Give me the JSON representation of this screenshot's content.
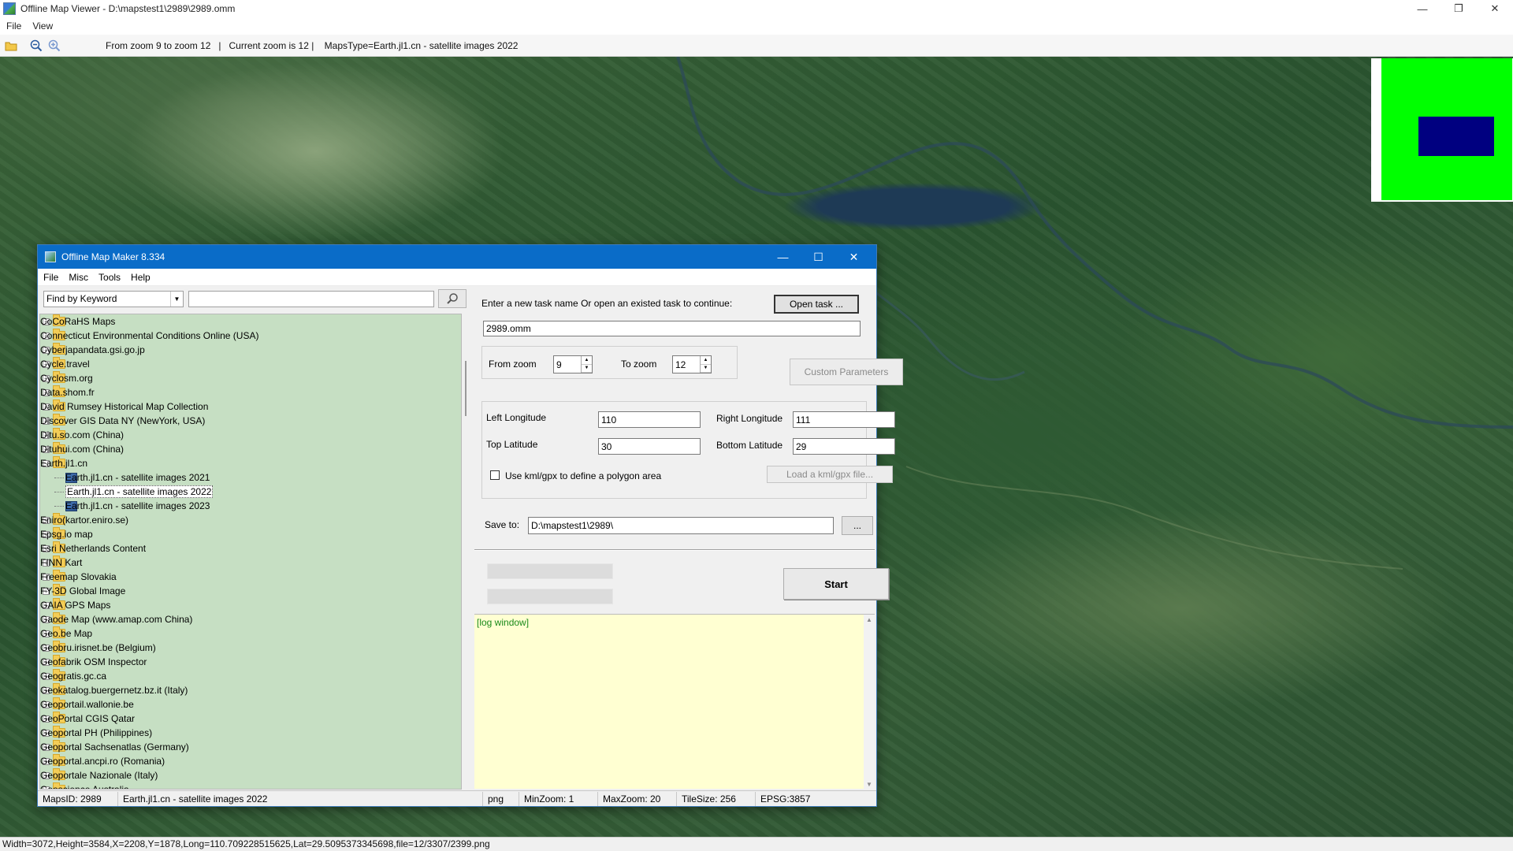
{
  "viewer": {
    "title": "Offline Map Viewer - D:\\mapstest1\\2989\\2989.omm",
    "menu": [
      "File",
      "View"
    ],
    "toolbar_info": "From zoom 9 to zoom 12   |   Current zoom is 12 |    MapsType=Earth.jl1.cn - satellite images 2022",
    "status": "Width=3072,Height=3584,X=2208,Y=1878,Long=110.709228515625,Lat=29.5095373345698,file=12/3307/2399.png"
  },
  "maker": {
    "title": "Offline Map Maker 8.334",
    "menu": [
      "File",
      "Misc",
      "Tools",
      "Help"
    ],
    "find_mode": "Find by Keyword",
    "find_text": "",
    "tree": [
      {
        "label": "CoCoRaHS Maps",
        "expanded": false
      },
      {
        "label": "Connecticut Environmental Conditions Online (USA)",
        "expanded": false
      },
      {
        "label": "Cyberjapandata.gsi.go.jp",
        "expanded": false
      },
      {
        "label": "Cycle.travel",
        "expanded": false
      },
      {
        "label": "Cyclosm.org",
        "expanded": false
      },
      {
        "label": "Data.shom.fr",
        "expanded": false
      },
      {
        "label": "David Rumsey Historical Map Collection",
        "expanded": false
      },
      {
        "label": "Discover GIS Data NY (NewYork, USA)",
        "expanded": false
      },
      {
        "label": "Ditu.so.com (China)",
        "expanded": false
      },
      {
        "label": "Dituhui.com (China)",
        "expanded": false
      },
      {
        "label": "Earth.jl1.cn",
        "expanded": true,
        "children": [
          {
            "label": "Earth.jl1.cn - satellite images 2021",
            "selected": false
          },
          {
            "label": "Earth.jl1.cn - satellite images 2022",
            "selected": true
          },
          {
            "label": "Earth.jl1.cn - satellite images 2023",
            "selected": false
          }
        ]
      },
      {
        "label": "Eniro(kartor.eniro.se)",
        "expanded": false
      },
      {
        "label": "Epsg.io map",
        "expanded": false
      },
      {
        "label": "Esri Netherlands Content",
        "expanded": false
      },
      {
        "label": "FINN Kart",
        "expanded": false
      },
      {
        "label": "Freemap Slovakia",
        "expanded": false
      },
      {
        "label": "FY-3D Global Image",
        "expanded": false
      },
      {
        "label": "GAIA GPS Maps",
        "expanded": false
      },
      {
        "label": "Gaode Map (www.amap.com China)",
        "expanded": false
      },
      {
        "label": "Geo.be Map",
        "expanded": false
      },
      {
        "label": "Geobru.irisnet.be (Belgium)",
        "expanded": false
      },
      {
        "label": "Geofabrik OSM Inspector",
        "expanded": false
      },
      {
        "label": "Geogratis.gc.ca",
        "expanded": false
      },
      {
        "label": "Geokatalog.buergernetz.bz.it (Italy)",
        "expanded": false
      },
      {
        "label": "Geoportail.wallonie.be",
        "expanded": false
      },
      {
        "label": "GeoPortal CGIS Qatar",
        "expanded": false
      },
      {
        "label": "Geoportal PH (Philippines)",
        "expanded": false
      },
      {
        "label": "Geoportal Sachsenatlas (Germany)",
        "expanded": false
      },
      {
        "label": "Geoportal.ancpi.ro (Romania)",
        "expanded": false
      },
      {
        "label": "Geoportale Nazionale (Italy)",
        "expanded": false
      },
      {
        "label": "Geoscience Australia",
        "expanded": false
      }
    ],
    "task_prompt": "Enter a new task name Or open an existed task to continue:",
    "open_task_label": "Open task ...",
    "task_name": "2989.omm",
    "from_zoom_label": "From zoom",
    "from_zoom": "9",
    "to_zoom_label": "To zoom",
    "to_zoom": "12",
    "custom_params_label": "Custom Parameters",
    "left_lon_label": "Left Longitude",
    "left_lon": "110",
    "right_lon_label": "Right Longitude",
    "right_lon": "111",
    "top_lat_label": "Top Latitude",
    "top_lat": "30",
    "bottom_lat_label": "Bottom Latitude",
    "bottom_lat": "29",
    "kml_checkbox_label": "Use kml/gpx to define a polygon area",
    "load_kml_label": "Load a kml/gpx file...",
    "save_to_label": "Save to:",
    "save_to": "D:\\mapstest1\\2989\\",
    "browse_label": "...",
    "start_label": "Start",
    "log_text": "[log window]",
    "status": {
      "maps_id": "MapsID: 2989",
      "maps_name": "Earth.jl1.cn - satellite images 2022",
      "format": "png",
      "min_zoom": "MinZoom: 1",
      "max_zoom": "MaxZoom: 20",
      "tile_size": "TileSize: 256",
      "epsg": "EPSG:3857"
    }
  }
}
